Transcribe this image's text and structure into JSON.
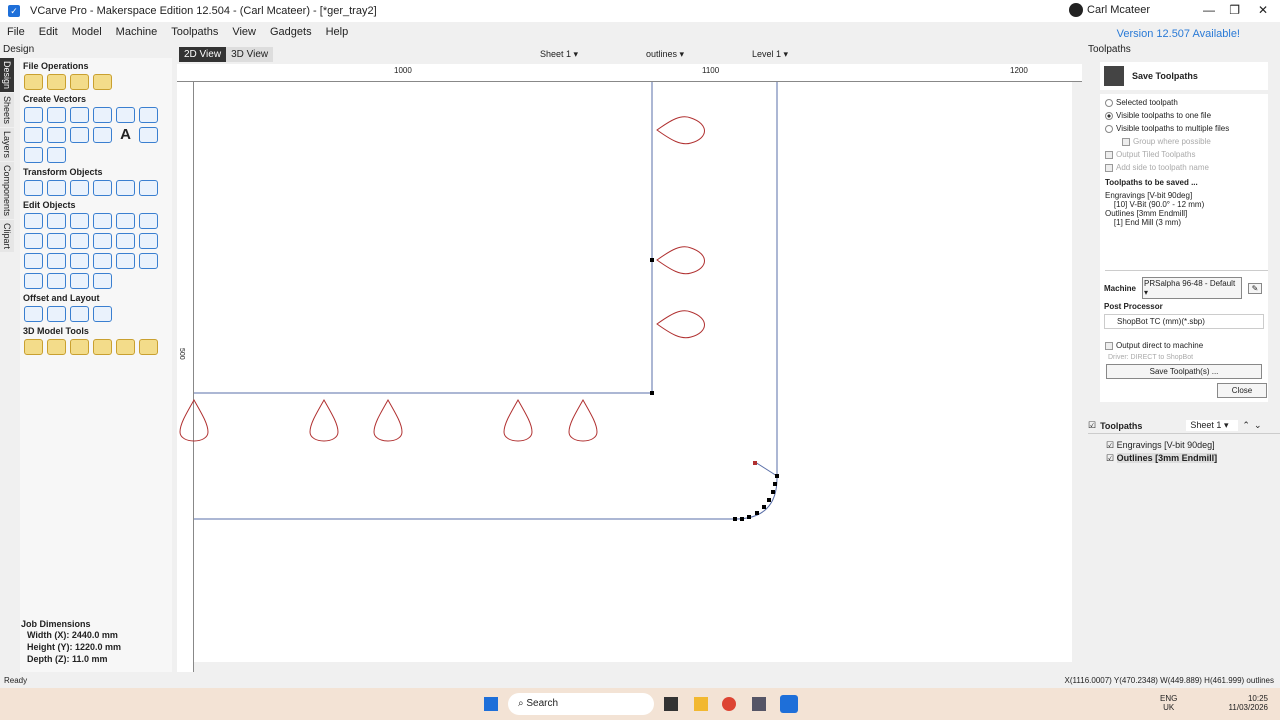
{
  "window": {
    "title": "VCarve Pro - Makerspace Edition 12.504 - (Carl Mcateer) - [*ger_tray2]",
    "user": "Carl Mcateer",
    "version_notice": "Version 12.507 Available!"
  },
  "menu": [
    "File",
    "Edit",
    "Model",
    "Machine",
    "Toolpaths",
    "View",
    "Gadgets",
    "Help"
  ],
  "left_panel": {
    "title": "Design",
    "vertical_tabs": [
      "Design",
      "Sheets",
      "Layers",
      "Components",
      "Clipart"
    ],
    "sections": [
      {
        "title": "File Operations",
        "icons": [
          "new-file",
          "open-file",
          "save-file",
          "import-file"
        ]
      },
      {
        "title": "Create Vectors",
        "icons": [
          "circle",
          "ellipse",
          "rectangle",
          "polygon",
          "star",
          "line",
          "arc",
          "curve",
          "wave",
          "component",
          "text",
          "text-on-curve",
          "spell-check",
          "trace"
        ]
      },
      {
        "title": "Transform Objects",
        "icons": [
          "move",
          "scale",
          "align",
          "mirror",
          "distort",
          "array"
        ]
      },
      {
        "title": "Edit Objects",
        "icons": [
          "select",
          "node-edit",
          "node-add",
          "transform",
          "group",
          "measure",
          "weld",
          "subtract",
          "trim",
          "join",
          "scissors",
          "smooth",
          "fillet",
          "triangle",
          "extend",
          "merge",
          "cut",
          "dimension",
          "rounded-rect",
          "close-vector",
          "offset-curve",
          "chevron"
        ]
      },
      {
        "title": "Offset and Layout",
        "icons": [
          "offset",
          "nest",
          "array-copy",
          "block"
        ]
      },
      {
        "title": "3D Model Tools",
        "icons": [
          "model-1",
          "model-2",
          "model-3",
          "model-4",
          "model-5",
          "model-6"
        ]
      }
    ],
    "job_dimensions": {
      "title": "Job Dimensions",
      "width": "Width  (X): 2440.0 mm",
      "height": "Height (Y): 1220.0 mm",
      "depth": "Depth  (Z): 11.0 mm"
    }
  },
  "view": {
    "tabs": [
      "2D View",
      "3D View"
    ],
    "sheet": "Sheet 1",
    "layer_group": "outlines",
    "level": "Level 1",
    "ruler_labels": [
      "1000",
      "1100",
      "1200"
    ],
    "left_ruler_label": "500"
  },
  "toolpaths_panel": {
    "title": "Toolpaths",
    "form_title": "Save Toolpaths",
    "options": [
      {
        "label": "Selected toolpath",
        "checked": false
      },
      {
        "label": "Visible toolpaths to one file",
        "checked": true
      },
      {
        "label": "Visible toolpaths to multiple files",
        "checked": false
      }
    ],
    "group_where_possible": "Group where possible",
    "output_tiled": "Output Tiled Toolpaths",
    "add_side": "Add side to toolpath name",
    "to_be_saved_title": "Toolpaths to be saved ...",
    "to_be_saved": [
      "Engravings [V-bit 90deg]",
      "    [10] V-Bit (90.0° - 12 mm)",
      "Outlines [3mm Endmill]",
      "    [1] End Mill (3 mm)"
    ],
    "machine_label": "Machine",
    "machine_value": "PRSalpha 96-48 - Default",
    "post_processor_label": "Post Processor",
    "post_processor_value": "ShopBot TC (mm)(*.sbp)",
    "output_direct": "Output direct to machine",
    "driver": "Driver: DIRECT to ShopBot",
    "save_button": "Save Toolpath(s) ...",
    "close_button": "Close",
    "list_title": "Toolpaths",
    "list_sheet": "Sheet 1",
    "list": [
      {
        "name": "Engravings [V-bit 90deg]",
        "checked": true
      },
      {
        "name": "Outlines [3mm Endmill]",
        "checked": true
      }
    ]
  },
  "status": {
    "left": "Ready",
    "right": "X(1116.0007) Y(470.2348)   W(449.889) H(461.999) outlines"
  },
  "taskbar": {
    "search": "Search",
    "lang1": "ENG",
    "lang2": "UK",
    "time": "10:25",
    "date": "11/03/2026"
  },
  "colors": {
    "vector_blue": "#5a6fa8",
    "teardrop_red": "#b03030",
    "accent": "#2a7ad6"
  }
}
